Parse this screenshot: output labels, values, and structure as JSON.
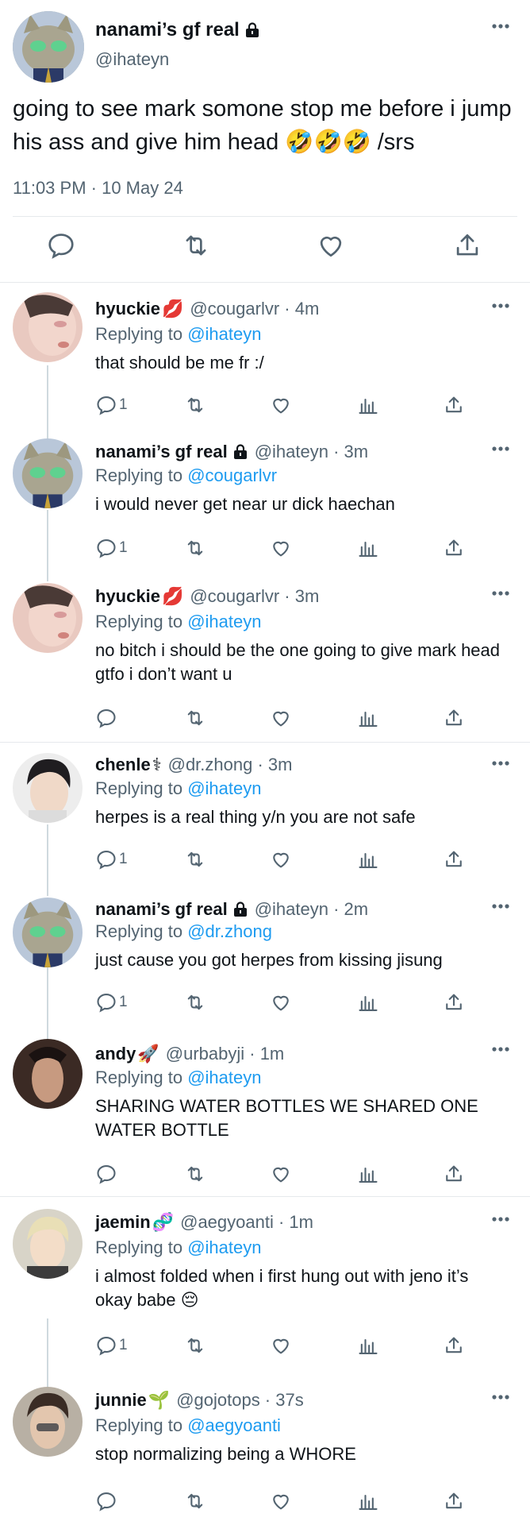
{
  "main_tweet": {
    "name": "nanami’s gf real",
    "handle": "@ihateyn",
    "text": "going to see mark somone stop me before i jump his ass and give him head 🤣🤣🤣 /srs",
    "timestamp": "11:03 PM · 10 May 24",
    "icons": [
      "reply-icon",
      "retweet-icon",
      "like-icon",
      "share-icon"
    ]
  },
  "replies": [
    {
      "name": "hyuckie",
      "emoji": "💋",
      "handle": "@cougarlvr · 4m",
      "replying_label": "Replying to",
      "replying_to": "@ihateyn",
      "text": "that should be me fr :/",
      "reply_count": "1"
    },
    {
      "name": "nanami’s gf real",
      "emoji": "",
      "handle": "@ihateyn · 3m",
      "replying_label": "Replying to",
      "replying_to": "@cougarlvr",
      "text": "i would never get near ur dick haechan",
      "reply_count": "1"
    },
    {
      "name": "hyuckie",
      "emoji": "💋",
      "handle": "@cougarlvr · 3m",
      "replying_label": "Replying to",
      "replying_to": "@ihateyn",
      "text": "no bitch i should be the one going to give mark head gtfo i don’t want u",
      "reply_count": ""
    },
    {
      "name": "chenle",
      "emoji": "⚕",
      "handle": "@dr.zhong · 3m",
      "replying_label": "Replying to",
      "replying_to": "@ihateyn",
      "text": "herpes is a real thing y/n you are not safe",
      "reply_count": "1"
    },
    {
      "name": "nanami’s gf real",
      "emoji": "",
      "handle": "@ihateyn · 2m",
      "replying_label": "Replying to",
      "replying_to": "@dr.zhong",
      "text": "just cause you got herpes from kissing jisung",
      "reply_count": "1"
    },
    {
      "name": "andy",
      "emoji": "🚀",
      "handle": "@urbabyji · 1m",
      "replying_label": "Replying to",
      "replying_to": "@ihateyn",
      "text": "SHARING WATER BOTTLES WE SHARED ONE WATER BOTTLE",
      "reply_count": ""
    },
    {
      "name": "jaemin",
      "emoji": "🧬",
      "handle": "@aegyoanti · 1m",
      "replying_label": "Replying to",
      "replying_to": "@ihateyn",
      "text": "i almost folded when i first hung out with jeno it’s okay babe 😔",
      "reply_count": "1"
    },
    {
      "name": "junnie",
      "emoji": "🌱",
      "handle": "@gojotops · 37s",
      "replying_label": "Replying to",
      "replying_to": "@aegyoanti",
      "text": "stop normalizing being a WHORE",
      "reply_count": ""
    }
  ],
  "colors": {
    "text": "#0f1419",
    "secondary": "#536471",
    "link": "#1d9bf0",
    "divider": "#e6e9ec",
    "thread_line": "#cfd9de"
  }
}
